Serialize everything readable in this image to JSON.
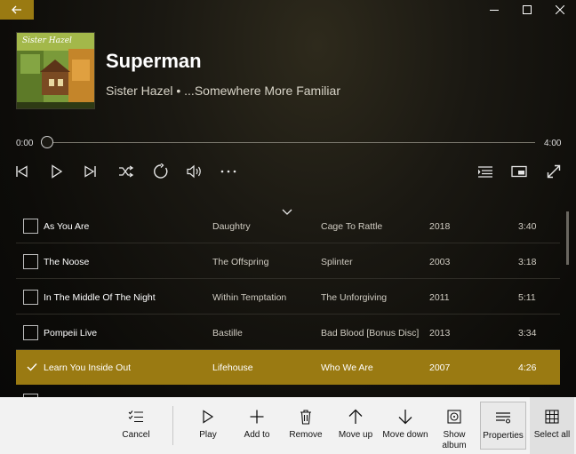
{
  "window": {
    "back_icon": "arrow-left-icon",
    "accent_color": "#9a7a12"
  },
  "now_playing": {
    "title": "Superman",
    "subtitle": "Sister Hazel • ...Somewhere More Familiar",
    "time_elapsed": "0:00",
    "time_total": "4:00",
    "progress": 0.0
  },
  "transport": [
    {
      "name": "previous-icon"
    },
    {
      "name": "play-icon"
    },
    {
      "name": "next-icon"
    },
    {
      "name": "shuffle-icon"
    },
    {
      "name": "repeat-icon"
    },
    {
      "name": "volume-icon"
    },
    {
      "name": "more-icon"
    },
    {
      "name": "now-playing-list-icon"
    },
    {
      "name": "mini-view-icon"
    },
    {
      "name": "full-screen-icon"
    }
  ],
  "tracks": [
    {
      "title": "As You Are",
      "artist": "Daughtry",
      "album": "Cage To Rattle",
      "year": "2018",
      "duration": "3:40",
      "selected": false
    },
    {
      "title": "The Noose",
      "artist": "The Offspring",
      "album": "Splinter",
      "year": "2003",
      "duration": "3:18",
      "selected": false
    },
    {
      "title": "In The Middle Of The Night",
      "artist": "Within Temptation",
      "album": "The Unforgiving",
      "year": "2011",
      "duration": "5:11",
      "selected": false
    },
    {
      "title": "Pompeii Live",
      "artist": "Bastille",
      "album": "Bad Blood [Bonus Disc] (",
      "year": "2013",
      "duration": "3:34",
      "selected": false
    },
    {
      "title": "Learn You Inside Out",
      "artist": "Lifehouse",
      "album": "Who We Are",
      "year": "2007",
      "duration": "4:26",
      "selected": true
    }
  ],
  "commands": {
    "cancel": "Cancel",
    "play": "Play",
    "add_to": "Add to",
    "remove": "Remove",
    "move_up": "Move up",
    "move_down": "Move down",
    "show_album": "Show\nalbum",
    "properties": "Properties",
    "select_all": "Select all"
  }
}
